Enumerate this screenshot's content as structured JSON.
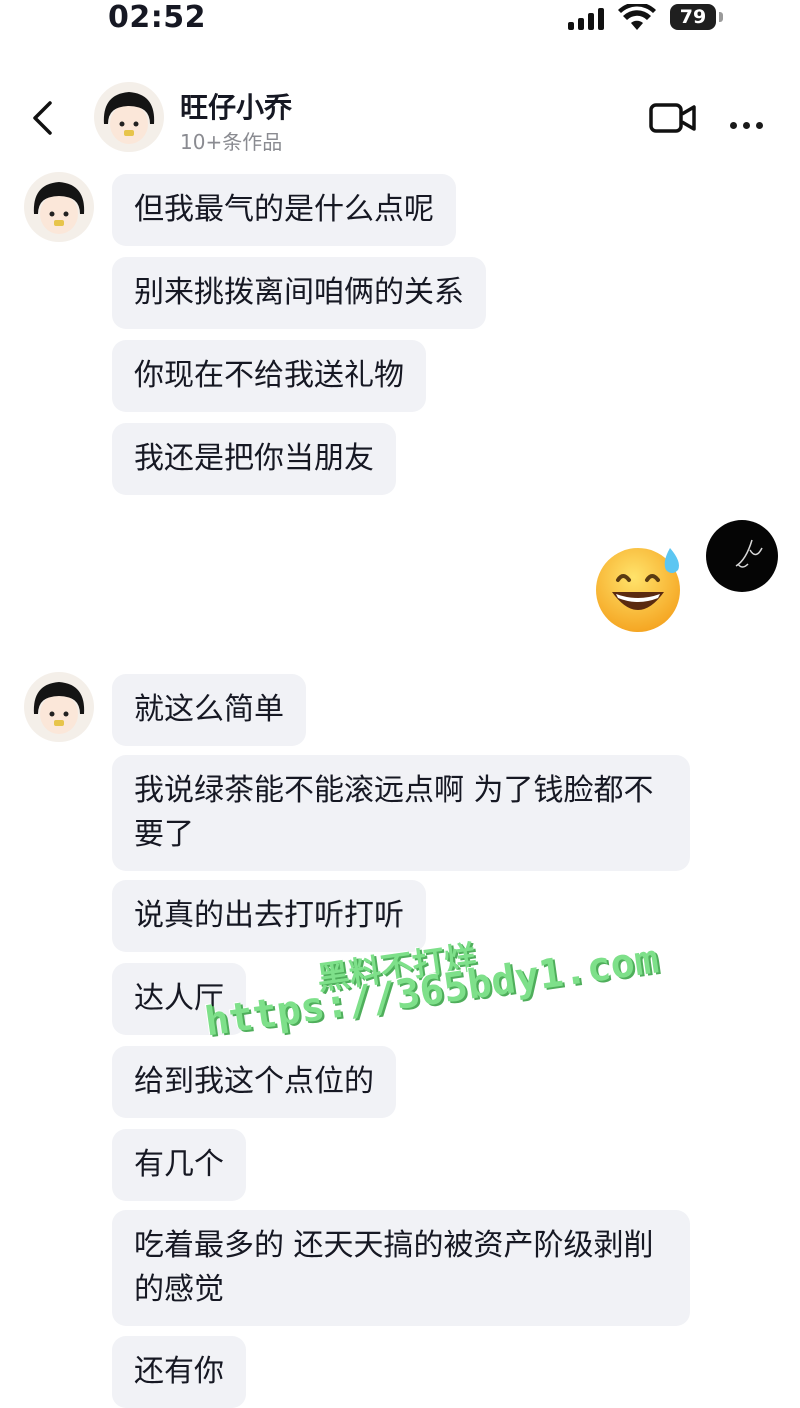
{
  "status_bar": {
    "time": "02:52",
    "battery": "79",
    "icons": [
      "signal-icon",
      "wifi-icon",
      "battery-icon"
    ]
  },
  "header": {
    "nickname": "旺仔小乔",
    "subtitle": "10+条作品",
    "icons": [
      "back-icon",
      "video-call-icon",
      "more-icon"
    ]
  },
  "messages_group1": [
    "但我最气的是什么点呢",
    "别来挑拨离间咱俩的关系",
    "你现在不给我送礼物",
    "我还是把你当朋友"
  ],
  "sent_message": {
    "emoji": "😅"
  },
  "messages_group2": [
    "就这么简单",
    "我说绿茶能不能滚远点啊 为了钱脸都不要了",
    "说真的出去打听打听",
    "达人厅",
    "给到我这个点位的",
    "有几个",
    "吃着最多的 还天天搞的被资产阶级剥削的感觉",
    "还有你"
  ],
  "watermark": {
    "line1": "黑料不打烊",
    "line2": "https://365bdy1.com"
  },
  "colors": {
    "bubble": "#f1f2f6",
    "text": "#161823",
    "subtext": "#8a8b91",
    "watermark": "#7ee08a"
  }
}
